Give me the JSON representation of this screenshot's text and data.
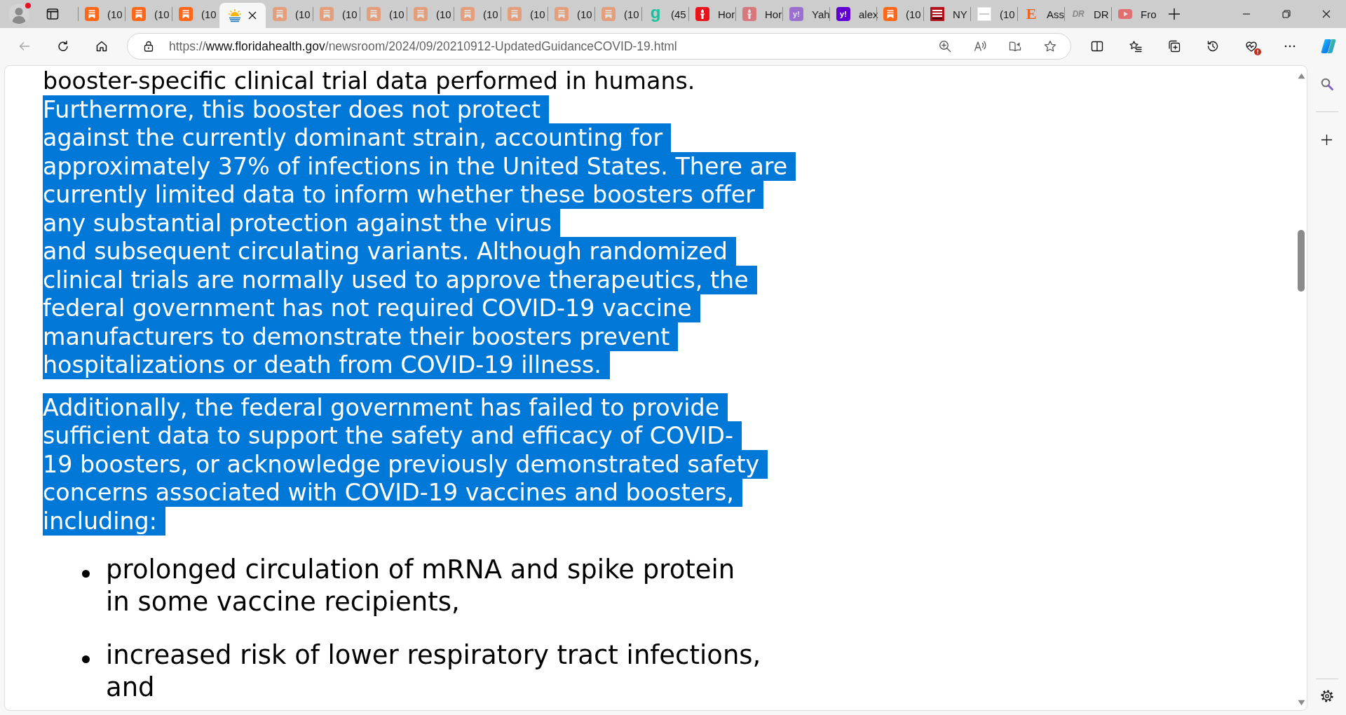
{
  "browser": {
    "profile": {
      "alert": true
    },
    "tabs": [
      {
        "kind": "bookmark",
        "title": "(10",
        "sleeping": false,
        "selected": false
      },
      {
        "kind": "bookmark",
        "title": "(10",
        "sleeping": false,
        "selected": false
      },
      {
        "kind": "bookmark",
        "title": "(10",
        "sleeping": false,
        "selected": false
      },
      {
        "kind": "sun",
        "sleeping": false,
        "selected": true
      },
      {
        "kind": "bookmark",
        "title": "(10",
        "sleeping": true,
        "selected": false
      },
      {
        "kind": "bookmark",
        "title": "(10",
        "sleeping": true,
        "selected": false
      },
      {
        "kind": "bookmark",
        "title": "(10",
        "sleeping": true,
        "selected": false
      },
      {
        "kind": "bookmark",
        "title": "(10",
        "sleeping": true,
        "selected": false
      },
      {
        "kind": "bookmark",
        "title": "(10",
        "sleeping": true,
        "selected": false
      },
      {
        "kind": "bookmark",
        "title": "(10",
        "sleeping": true,
        "selected": false
      },
      {
        "kind": "bookmark",
        "title": "(10",
        "sleeping": true,
        "selected": false
      },
      {
        "kind": "bookmark",
        "title": "(10",
        "sleeping": true,
        "selected": false
      },
      {
        "kind": "letter",
        "icon_text": "g",
        "title": "(45",
        "sleeping": false,
        "selected": false
      },
      {
        "kind": "torch",
        "title": "Hor",
        "sleeping": false,
        "selected": false
      },
      {
        "kind": "torch",
        "title": "Hor",
        "sleeping": true,
        "selected": false
      },
      {
        "kind": "tile",
        "icon_text": "y!",
        "title": "Yah",
        "sleeping": true,
        "selected": false
      },
      {
        "kind": "tile",
        "icon_text": "y!",
        "title": "alex",
        "sleeping": false,
        "selected": false
      },
      {
        "kind": "bookmark",
        "title": "(10",
        "sleeping": false,
        "selected": false
      },
      {
        "kind": "newspaper",
        "title": "NY",
        "sleeping": false,
        "selected": false
      },
      {
        "kind": "thumbnail",
        "title": "(10",
        "sleeping": false,
        "selected": false
      },
      {
        "kind": "serif",
        "icon_text": "E",
        "title": "Ass",
        "sleeping": false,
        "selected": false
      },
      {
        "kind": "italic",
        "icon_text": "DR",
        "title": "DR",
        "sleeping": true,
        "selected": false
      },
      {
        "kind": "play",
        "title": "Fro",
        "sleeping": true,
        "selected": false
      }
    ],
    "toolbar": {
      "back": {
        "disabled": true
      },
      "address": {
        "scheme": "https://",
        "host": "www.floridahealth.gov",
        "path": "/newsroom/2024/09/20210912-UpdatedGuidanceCOVID-19.html"
      },
      "essentials": {
        "alert": true
      }
    }
  },
  "page": {
    "paragraphs": [
      {
        "segments": [
          {
            "text": "booster-specific clinical trial data performed in humans. ",
            "selected": false
          },
          {
            "text": "Furthermore, this booster does not protect\nagainst the currently dominant strain, accounting for\napproximately 37% of infections in the United States. There are\ncurrently limited data to inform whether these boosters offer\nany substantial protection against the virus\nand subsequent circulating variants. Although randomized\nclinical trials are normally used to approve therapeutics, the\nfederal government has not required COVID-19 vaccine\nmanufacturers to demonstrate their boosters prevent\nhospitalizations or death from COVID-19 illness.",
            "selected": true
          }
        ]
      },
      {
        "segments": [
          {
            "text": "Additionally, the federal government has failed to provide\nsufficient data to support the safety and efficacy of COVID-\n19 boosters, or acknowledge previously demonstrated safety\nconcerns associated with COVID-19 vaccines and boosters,\nincluding:",
            "selected": true
          }
        ]
      }
    ],
    "bullets": [
      "prolonged circulation of mRNA and spike protein\nin some vaccine recipients,",
      "increased risk of lower respiratory tract infections,\nand"
    ]
  }
}
